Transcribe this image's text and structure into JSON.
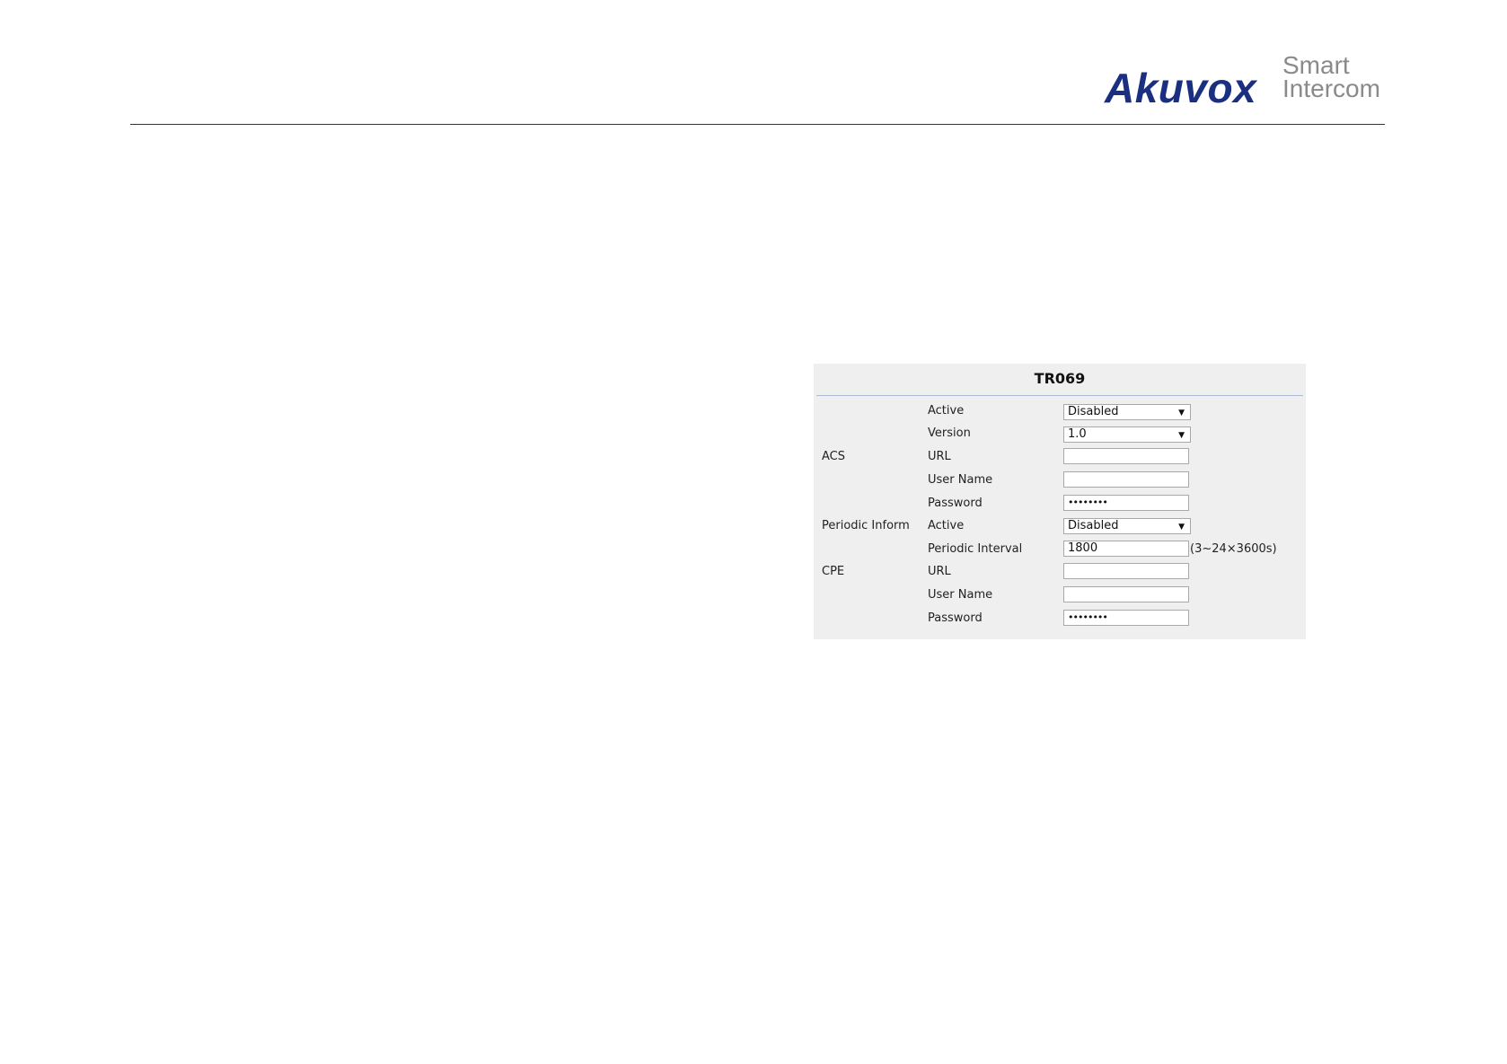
{
  "logo": {
    "brand": "Akuvox",
    "tagline_line1": "Smart",
    "tagline_line2": "Intercom"
  },
  "panel": {
    "title": "TR069",
    "sections": {
      "acs": "ACS",
      "periodic": "Periodic Inform",
      "cpe": "CPE"
    },
    "acs": {
      "active_label": "Active",
      "active_value": "Disabled",
      "version_label": "Version",
      "version_value": "1.0",
      "url_label": "URL",
      "url_value": "",
      "username_label": "User Name",
      "username_value": "",
      "password_label": "Password",
      "password_value": "••••••••"
    },
    "periodic": {
      "active_label": "Active",
      "active_value": "Disabled",
      "interval_label": "Periodic Interval",
      "interval_value": "1800",
      "interval_hint": "(3~24×3600s)"
    },
    "cpe": {
      "url_label": "URL",
      "url_value": "",
      "username_label": "User Name",
      "username_value": "",
      "password_label": "Password",
      "password_value": "••••••••"
    },
    "dropdown_arrow": "▼"
  }
}
